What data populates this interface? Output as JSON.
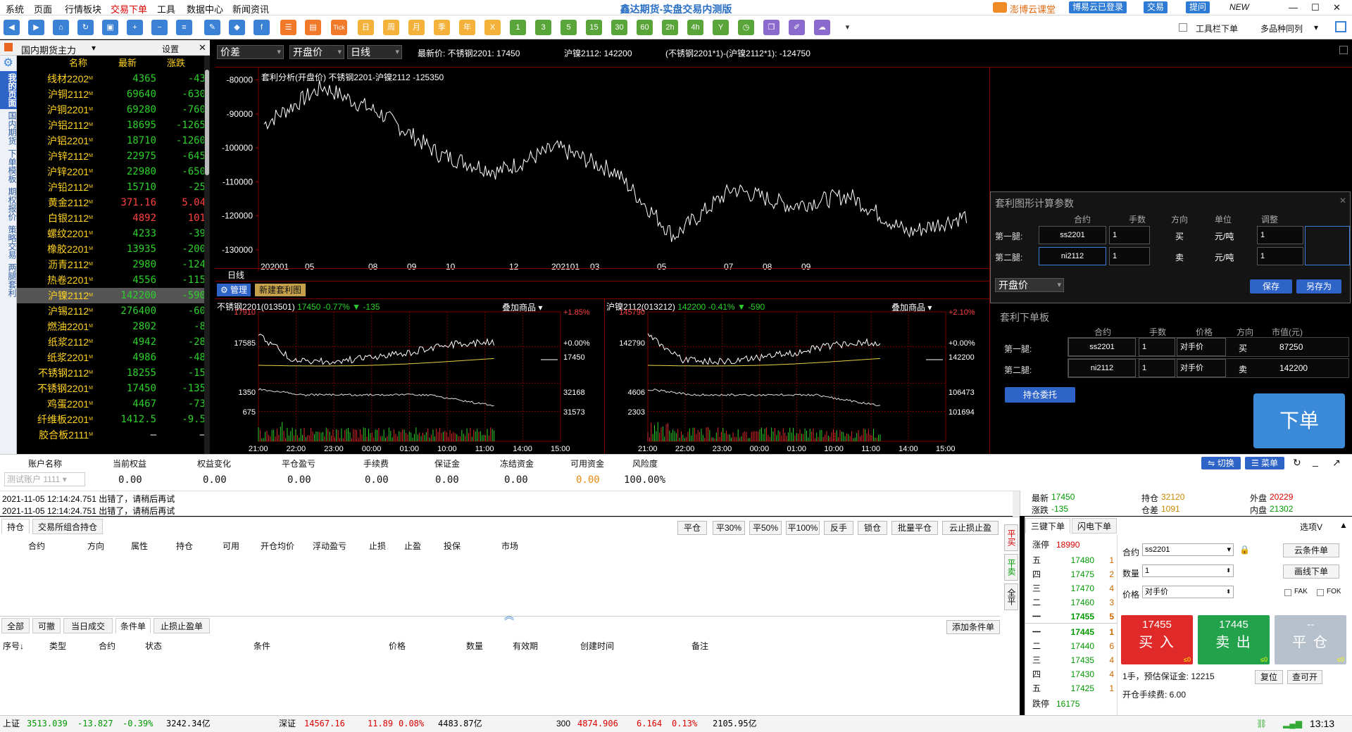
{
  "menu": {
    "items": [
      "系统",
      "页面",
      "行情板块",
      "交易下单",
      "工具",
      "数据中心",
      "新闻资讯"
    ],
    "title": "鑫达期货-实盘交易内测版",
    "right": {
      "class": "澎博云课堂",
      "login": "博易云已登录",
      "trade": "交易",
      "help": "提问",
      "new": "NEW"
    }
  },
  "toolbar": {
    "labels": [
      "Tick",
      "日",
      "周",
      "月",
      "季",
      "年",
      "X",
      "1",
      "3",
      "5",
      "15",
      "30",
      "60",
      "2h",
      "4h",
      "Y"
    ],
    "toolbar_order": "工具栏下单",
    "multi": "多品种同列"
  },
  "left": {
    "header": "国内期货主力",
    "settings": "设置",
    "col_name": "名称",
    "col_price": "最新",
    "col_change": "涨跌",
    "vtabs": [
      "我的页面",
      "国内期货",
      "下单模板",
      "期权报价",
      "策略交易",
      "两腿套利"
    ],
    "rows": [
      {
        "name": "线材2202",
        "price": "4365",
        "change": "-43",
        "color": "#2cd12c"
      },
      {
        "name": "沪铜2112",
        "price": "69640",
        "change": "-630",
        "color": "#2cd12c"
      },
      {
        "name": "沪铜2201",
        "price": "69280",
        "change": "-760",
        "color": "#2cd12c"
      },
      {
        "name": "沪铝2112",
        "price": "18695",
        "change": "-1265",
        "color": "#2cd12c"
      },
      {
        "name": "沪铝2201",
        "price": "18710",
        "change": "-1260",
        "color": "#2cd12c"
      },
      {
        "name": "沪锌2112",
        "price": "22975",
        "change": "-645",
        "color": "#2cd12c"
      },
      {
        "name": "沪锌2201",
        "price": "22980",
        "change": "-650",
        "color": "#2cd12c"
      },
      {
        "name": "沪铅2112",
        "price": "15710",
        "change": "-25",
        "color": "#2cd12c"
      },
      {
        "name": "黄金2112",
        "price": "371.16",
        "change": "5.04",
        "color": "#ff4040"
      },
      {
        "name": "白银2112",
        "price": "4892",
        "change": "101",
        "color": "#ff4040"
      },
      {
        "name": "螺纹2201",
        "price": "4233",
        "change": "-39",
        "color": "#2cd12c"
      },
      {
        "name": "橡胶2201",
        "price": "13935",
        "change": "-200",
        "color": "#2cd12c"
      },
      {
        "name": "沥青2112",
        "price": "2980",
        "change": "-124",
        "color": "#2cd12c"
      },
      {
        "name": "热卷2201",
        "price": "4556",
        "change": "-115",
        "color": "#2cd12c"
      },
      {
        "name": "沪镍2112",
        "price": "142200",
        "change": "-590",
        "color": "#2cd12c",
        "sel": true
      },
      {
        "name": "沪锡2112",
        "price": "276400",
        "change": "-60",
        "color": "#2cd12c"
      },
      {
        "name": "燃油2201",
        "price": "2802",
        "change": "-8",
        "color": "#2cd12c"
      },
      {
        "name": "纸浆2112",
        "price": "4942",
        "change": "-28",
        "color": "#2cd12c"
      },
      {
        "name": "纸浆2201",
        "price": "4986",
        "change": "-48",
        "color": "#2cd12c"
      },
      {
        "name": "不锈钢2112",
        "price": "18255",
        "change": "-15",
        "color": "#2cd12c"
      },
      {
        "name": "不锈钢2201",
        "price": "17450",
        "change": "-135",
        "color": "#2cd12c"
      },
      {
        "name": "鸡蛋2201",
        "price": "4467",
        "change": "-73",
        "color": "#2cd12c"
      },
      {
        "name": "纤维板2201",
        "price": "1412.5",
        "change": "-9.5",
        "color": "#2cd12c"
      },
      {
        "name": "胶合板2111",
        "price": "–",
        "change": "–",
        "color": "#fff"
      }
    ]
  },
  "chart": {
    "sel1": "价差",
    "sel2": "开盘价",
    "sel3": "日线",
    "info1": "最新价: 不锈钢2201: 17450",
    "info2": "沪镍2112: 142200",
    "info3": "(不锈钢2201*1)-(沪镍2112*1): -124750",
    "title": "套利分析(开盘价) 不锈钢2201-沪镍2112 -125350",
    "period_label": "日线",
    "yticks": [
      "-80000",
      "-90000",
      "-100000",
      "-110000",
      "-120000",
      "-130000"
    ],
    "xticks": [
      "202001",
      "05",
      "08",
      "09",
      "10",
      "12",
      "202101",
      "03",
      "05",
      "07",
      "08",
      "09"
    ],
    "manage": "管理",
    "new_chart": "新建套利图"
  },
  "chart_data": {
    "type": "line",
    "title": "套利分析(开盘价) 不锈钢2201-沪镍2112 -125350",
    "ylim": [
      -135000,
      -77000
    ],
    "x": [
      "202001",
      "05",
      "08",
      "09",
      "10",
      "12",
      "202101",
      "03",
      "05",
      "07",
      "08",
      "09"
    ],
    "values": [
      -93000,
      -82000,
      -90000,
      -102000,
      -107000,
      -100000,
      -107000,
      -126000,
      -112000,
      -117000,
      -114000,
      -125000,
      -120000
    ]
  },
  "mini1": {
    "title": "不锈钢2201(013501)",
    "price": "17450",
    "pct": "-0.77%",
    "chg": "-135",
    "overlay": "叠加商品",
    "yl": [
      "17910",
      "17585",
      "1350",
      "675"
    ],
    "yr": [
      "+1.85%",
      "+0.00%",
      "17450",
      "32168",
      "31573"
    ],
    "xt": [
      "21:00",
      "22:00",
      "23:00",
      "00:00",
      "01:00",
      "10:00",
      "11:00",
      "14:00",
      "15:00"
    ]
  },
  "mini2": {
    "title": "沪镍2112(013212)",
    "price": "142200",
    "pct": "-0.41%",
    "chg": "-590",
    "overlay": "叠加商品",
    "yl": [
      "145790",
      "142790",
      "4606",
      "2303"
    ],
    "yr": [
      "+2.10%",
      "+0.00%",
      "142200",
      "106473",
      "101694"
    ],
    "xt": [
      "21:00",
      "22:00",
      "23:00",
      "00:00",
      "01:00",
      "10:00",
      "11:00",
      "14:00",
      "15:00"
    ]
  },
  "params": {
    "title": "套利图形计算参数",
    "cols": [
      "合约",
      "手数",
      "方向",
      "单位",
      "调整"
    ],
    "leg1": {
      "label": "第一腿:",
      "contract": "ss2201",
      "qty": "1",
      "dir": "买",
      "unit": "元/吨",
      "adj": "1"
    },
    "leg2": {
      "label": "第二腿:",
      "contract": "ni2112",
      "qty": "1",
      "dir": "卖",
      "unit": "元/吨",
      "adj": "1"
    },
    "select": "开盘价",
    "save": "保存",
    "saveas": "另存为"
  },
  "order_board": {
    "title": "套利下单板",
    "cols": [
      "合约",
      "手数",
      "价格",
      "方向",
      "市值(元)"
    ],
    "leg1": {
      "label": "第一腿:",
      "contract": "ss2201",
      "qty": "1",
      "price": "对手价",
      "dir": "买",
      "value": "87250"
    },
    "leg2": {
      "label": "第二腿:",
      "contract": "ni2112",
      "qty": "1",
      "price": "对手价",
      "dir": "卖",
      "value": "142200"
    },
    "hold": "持仓委托",
    "submit": "下单"
  },
  "account": {
    "cols": [
      "账户名称",
      "当前权益",
      "权益变化",
      "平仓盈亏",
      "手续费",
      "保证金",
      "冻结资金",
      "可用资金",
      "风险度"
    ],
    "name": "测试账户 1111",
    "values": [
      "0.00",
      "0.00",
      "0.00",
      "0.00",
      "0.00",
      "0.00",
      "0.00",
      "100.00%"
    ],
    "switch": "切换",
    "menu": "菜单"
  },
  "log": [
    "2021-11-05 12:14:24.751    出错了，请稍后再试",
    "2021-11-05 12:14:24.751    出错了，请稍后再试"
  ],
  "quote": {
    "latest_l": "最新",
    "latest": "17450",
    "hold_l": "持仓",
    "hold": "32120",
    "out_l": "外盘",
    "out": "20229",
    "chg_l": "涨跌",
    "chg": "-135",
    "diff_l": "仓差",
    "diff": "1091",
    "in_l": "内盘",
    "in": "21302"
  },
  "positions": {
    "tabs": [
      "持仓",
      "交易所组合持仓"
    ],
    "buttons": [
      "平仓",
      "平30%",
      "平50%",
      "平100%",
      "反手",
      "锁仓",
      "批量平仓",
      "云止损止盈"
    ],
    "cols": [
      "合约",
      "方向",
      "属性",
      "持仓",
      "可用",
      "开仓均价",
      "浮动盈亏",
      "止损",
      "止盈",
      "投保",
      "市场"
    ],
    "side": [
      "平买",
      "平卖",
      "全平"
    ]
  },
  "orders": {
    "tabs": [
      "全部",
      "可撤",
      "当日成交",
      "条件单",
      "止损止盈单"
    ],
    "add": "添加条件单",
    "cols": [
      "序号↓",
      "类型",
      "合约",
      "状态",
      "条件",
      "价格",
      "数量",
      "有效期",
      "创建时间",
      "备注"
    ]
  },
  "trade": {
    "tabs": [
      "三键下单",
      "闪电下单"
    ],
    "options": "选项V",
    "limit_up_l": "涨停",
    "limit_up": "18990",
    "limit_down_l": "跌停",
    "limit_down": "16175",
    "asks": [
      {
        "l": "五",
        "p": "17480",
        "v": "1"
      },
      {
        "l": "四",
        "p": "17475",
        "v": "2"
      },
      {
        "l": "三",
        "p": "17470",
        "v": "4"
      },
      {
        "l": "二",
        "p": "17460",
        "v": "3"
      },
      {
        "l": "一",
        "p": "17455",
        "v": "5"
      }
    ],
    "bids": [
      {
        "l": "一",
        "p": "17445",
        "v": "1"
      },
      {
        "l": "二",
        "p": "17440",
        "v": "6"
      },
      {
        "l": "三",
        "p": "17435",
        "v": "4"
      },
      {
        "l": "四",
        "p": "17430",
        "v": "4"
      },
      {
        "l": "五",
        "p": "17425",
        "v": "1"
      }
    ],
    "contract_l": "合约",
    "contract": "ss2201",
    "qty_l": "数量",
    "qty": "1",
    "price_l": "价格",
    "price": "对手价",
    "cloud": "云条件单",
    "draw": "画线下单",
    "fak": "FAK",
    "fok": "FOK",
    "buy_price": "17455",
    "buy": "买 入",
    "sell_price": "17445",
    "sell": "卖 出",
    "close_price": "--",
    "close": "平 仓",
    "count": "≤0",
    "margin": "1手，预估保证金: 12215",
    "fee": "开仓手续费: 6.00",
    "reset": "复位",
    "reopen": "查可开"
  },
  "status": {
    "sh_l": "上证",
    "sh": "3513.039",
    "sh_c": "-13.827",
    "sh_p": "-0.39%",
    "sh_v": "3242.34亿",
    "sz_l": "深证",
    "sz": "14567.16",
    "sz_c": "11.89",
    "sz_p": "0.08%",
    "sz_v": "4483.87亿",
    "cy_l": "300",
    "cy": "4874.906",
    "cy_c": "6.164",
    "cy_p": "0.13%",
    "cy_v": "2105.95亿",
    "time": "13:13"
  }
}
